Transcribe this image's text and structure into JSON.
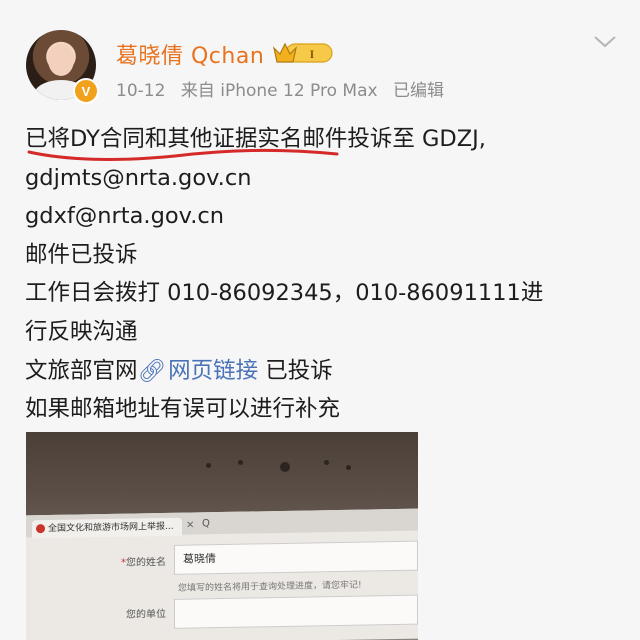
{
  "header": {
    "username": "葛晓倩 Qchan",
    "level_badge": "I",
    "date": "10-12",
    "source": "来自 iPhone 12 Pro Max",
    "edited": "已编辑",
    "verified_mark": "V"
  },
  "post": {
    "lines": {
      "l1_underlined": "已将DY合同和其他证据实",
      "l1_rest": "名邮件投诉至 GDZJ,",
      "l2": "gdjmts@nrta.gov.cn",
      "l3": "gdxf@nrta.gov.cn",
      "l4": "邮件已投诉",
      "l5": "工作日会拨打 010-86092345，010-86091111进",
      "l6": "行反映沟通",
      "l7_prefix": "文旅部官网",
      "l7_link": "网页链接",
      "l7_suffix": " 已投诉",
      "l8": "如果邮箱地址有误可以进行补充"
    },
    "link_icon": "🔗",
    "annotation_color": "#d42a2a"
  },
  "attachment": {
    "browser_tab": "全国文化和旅游市场网上举报...",
    "tab_close": "×",
    "tab_search": "Q",
    "form": {
      "name_label": "您的姓名",
      "name_value": "葛晓倩",
      "name_hint": "您填写的姓名将用于查询处理进度，请您牢记!",
      "unit_label": "您的单位"
    }
  },
  "colors": {
    "username": "#e8731f",
    "meta": "#8c8c8c",
    "link": "#4a72b8",
    "badge": "#f0a21c"
  }
}
